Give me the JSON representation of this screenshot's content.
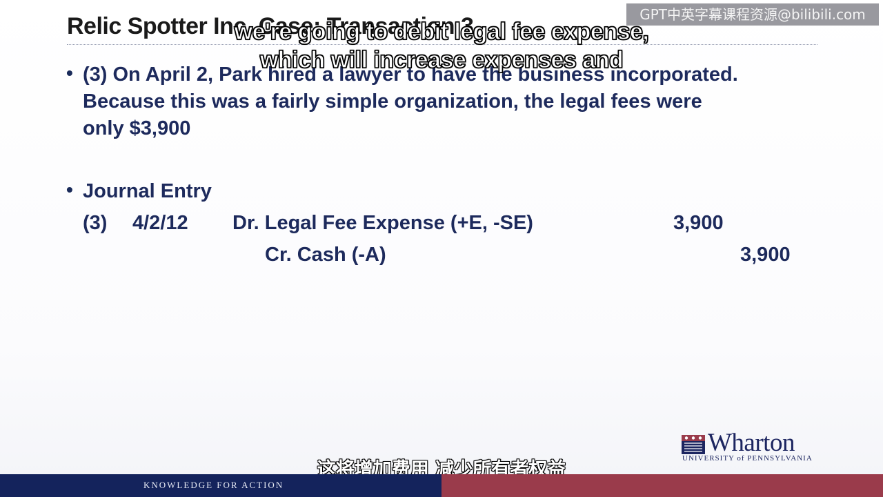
{
  "slide": {
    "title": "Relic Spotter Inc. Case: Transaction 3",
    "bullets": [
      {
        "marker": "•",
        "lines": [
          "(3) On April 2, Park hired a lawyer to have the business incorporated.",
          "Because this was a fairly simple organization, the legal fees were",
          "only $3,900"
        ]
      },
      {
        "marker": "•",
        "lines": [
          "Journal Entry"
        ]
      }
    ],
    "journal_entry": {
      "number": "(3)",
      "date": "4/2/12",
      "debit_account": "Dr. Legal Fee Expense (+E, -SE)",
      "debit_amount": "3,900",
      "credit_account": "Cr. Cash (-A)",
      "credit_amount": "3,900"
    }
  },
  "subtitles": {
    "english_line1": "we're going to debit legal fee expense,",
    "english_line2": "which will increase expenses and",
    "chinese": "这将增加费用 减少所有者权益"
  },
  "watermark": "GPT中英字幕课程资源@bilibili.com",
  "branding": {
    "logo_word": "Wharton",
    "logo_sub": "UNIVERSITY of PENNSYLVANIA",
    "tagline": "KNOWLEDGE FOR ACTION",
    "colors": {
      "navy": "#14235c",
      "maroon": "#9a3b4b",
      "text_blue": "#1d2a5c"
    }
  }
}
